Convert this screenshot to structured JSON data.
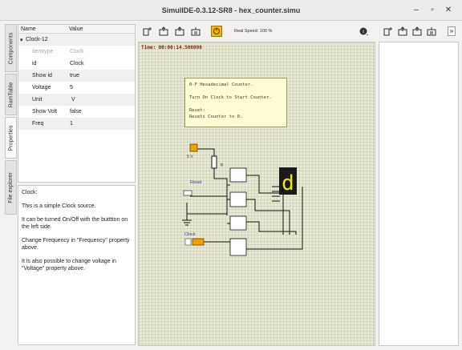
{
  "window": {
    "title": "SimulIDE-0.3.12-SR8  -  hex_counter.simu",
    "minimize": "–",
    "maximize": "▫",
    "close": "✕"
  },
  "side_tabs": [
    "Components",
    "RamTable",
    "Properties",
    "File explorer"
  ],
  "properties": {
    "header_name": "Name",
    "header_value": "Value",
    "component": "Clock-12",
    "rows": [
      {
        "name": "itemtype",
        "value": "Clock"
      },
      {
        "name": "id",
        "value": "Clock"
      },
      {
        "name": "Show id",
        "value": "true"
      },
      {
        "name": "Voltage",
        "value": "5"
      },
      {
        "name": "Unit",
        "value": "V"
      },
      {
        "name": "Show Volt",
        "value": "false"
      },
      {
        "name": "Freq",
        "value": "1"
      }
    ]
  },
  "help": {
    "title": "Clock:",
    "p1": "This is a simple Clock source.",
    "p2": "It can be turned On/Off with the butttton on the left side.",
    "p3": "Change Frequency in \"Frequency\" property above.",
    "p4": "It is also possible to change voltage in \"Voltage\" property above."
  },
  "toolbar": {
    "speed_label": "Real Speed: 100 %"
  },
  "canvas": {
    "time": "Time: 00:00:14.500000",
    "note_lines": [
      "0-F Hexadecimal Counter.",
      "",
      "Turn On Clock to Start Counter.",
      "",
      "Reset:",
      "Resets Counter to 0."
    ],
    "supply_label": "5 V",
    "resistor_label": "1k",
    "reset_label": "Reset",
    "clock_label": "Clock",
    "display_digit": "d"
  },
  "colors": {
    "canvas_bg": "#e9ead6",
    "note_bg": "#fffed2",
    "accent_orange": "#f0a000"
  }
}
